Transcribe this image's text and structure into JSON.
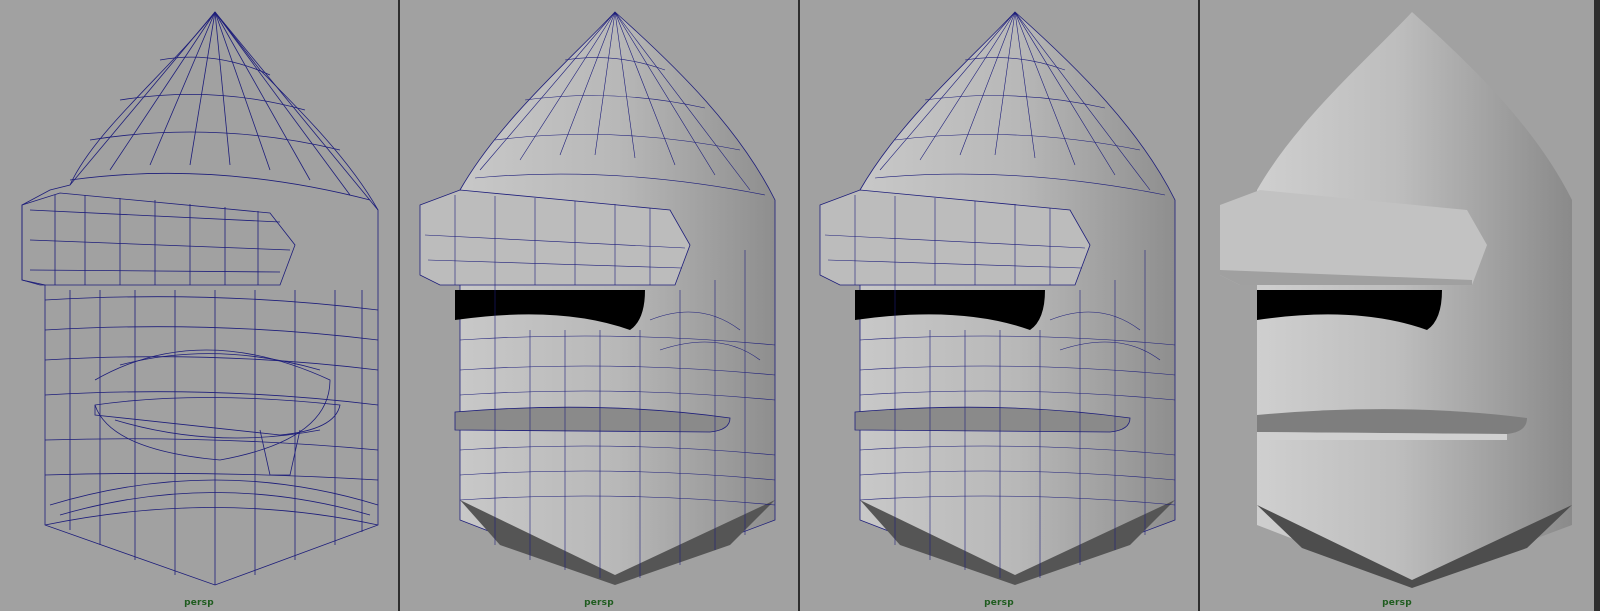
{
  "viewports": [
    {
      "camera": "persp",
      "display_mode": "wireframe"
    },
    {
      "camera": "persp",
      "display_mode": "smooth-shaded-wireframe-on-shaded"
    },
    {
      "camera": "persp",
      "display_mode": "smooth-shaded-wireframe-on-shaded"
    },
    {
      "camera": "persp",
      "display_mode": "smooth-shaded"
    }
  ],
  "colors": {
    "viewport_bg": "#a1a1a1",
    "wire": "#1d1d7a",
    "label": "#1f5c1f"
  }
}
